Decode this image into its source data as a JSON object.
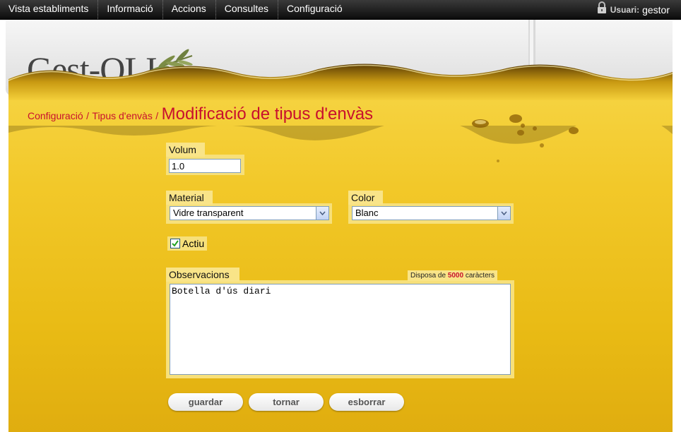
{
  "nav": {
    "items": [
      {
        "label": "Vista establiments"
      },
      {
        "label": "Informació"
      },
      {
        "label": "Accions"
      },
      {
        "label": "Consultes"
      },
      {
        "label": "Configuració"
      }
    ],
    "user_label": "Usuari:",
    "user_name": "gestor"
  },
  "logo": {
    "text": "Gest-OLI"
  },
  "breadcrumb": {
    "items": [
      "Configuració",
      "Tipus d'envàs"
    ],
    "separator": "/",
    "current": "Modificació de tipus d'envàs"
  },
  "form": {
    "volum": {
      "label": "Volum",
      "value": "1.0"
    },
    "material": {
      "label": "Material",
      "selected": "Vidre transparent"
    },
    "color": {
      "label": "Color",
      "selected": "Blanc"
    },
    "actiu": {
      "label": "Actiu",
      "checked": true
    },
    "observacions": {
      "label": "Observacions",
      "value": "Botella d'ús diari",
      "chars_prefix": "Disposa de",
      "chars_count": "5000",
      "chars_suffix": "caràcters"
    }
  },
  "buttons": {
    "save": "guardar",
    "back": "tornar",
    "delete": "esborrar"
  },
  "colors": {
    "accent": "#c8102e",
    "oil": "#f2c829",
    "nav_bg": "#1a1a1a"
  },
  "icons": [
    "lock-icon",
    "olive-branch-icon",
    "chevron-down-icon",
    "checkmark-icon"
  ]
}
